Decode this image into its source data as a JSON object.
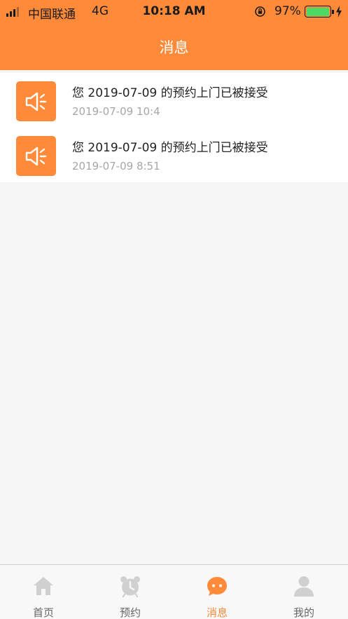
{
  "status_bar": {
    "carrier": "中国联通",
    "network": "4G",
    "time": "10:18 AM",
    "battery_percent": "97%",
    "battery_level": 0.97
  },
  "header": {
    "title": "消息",
    "background_color": "#ff8a3a"
  },
  "messages": [
    {
      "icon": "speaker-icon",
      "title": "您 2019-07-09 的预约上门已被接受",
      "time": "2019-07-09 10:4"
    },
    {
      "icon": "speaker-icon",
      "title": "您 2019-07-09 的预约上门已被接受",
      "time": "2019-07-09 8:51"
    }
  ],
  "tabbar": {
    "items": [
      {
        "label": "首页",
        "icon": "home-icon",
        "active": false
      },
      {
        "label": "预约",
        "icon": "alarm-clock-icon",
        "active": false
      },
      {
        "label": "消息",
        "icon": "chat-bubble-icon",
        "active": true
      },
      {
        "label": "我的",
        "icon": "person-icon",
        "active": false
      }
    ],
    "active_color": "#ff8a3a",
    "inactive_color": "#d0d0d0"
  }
}
